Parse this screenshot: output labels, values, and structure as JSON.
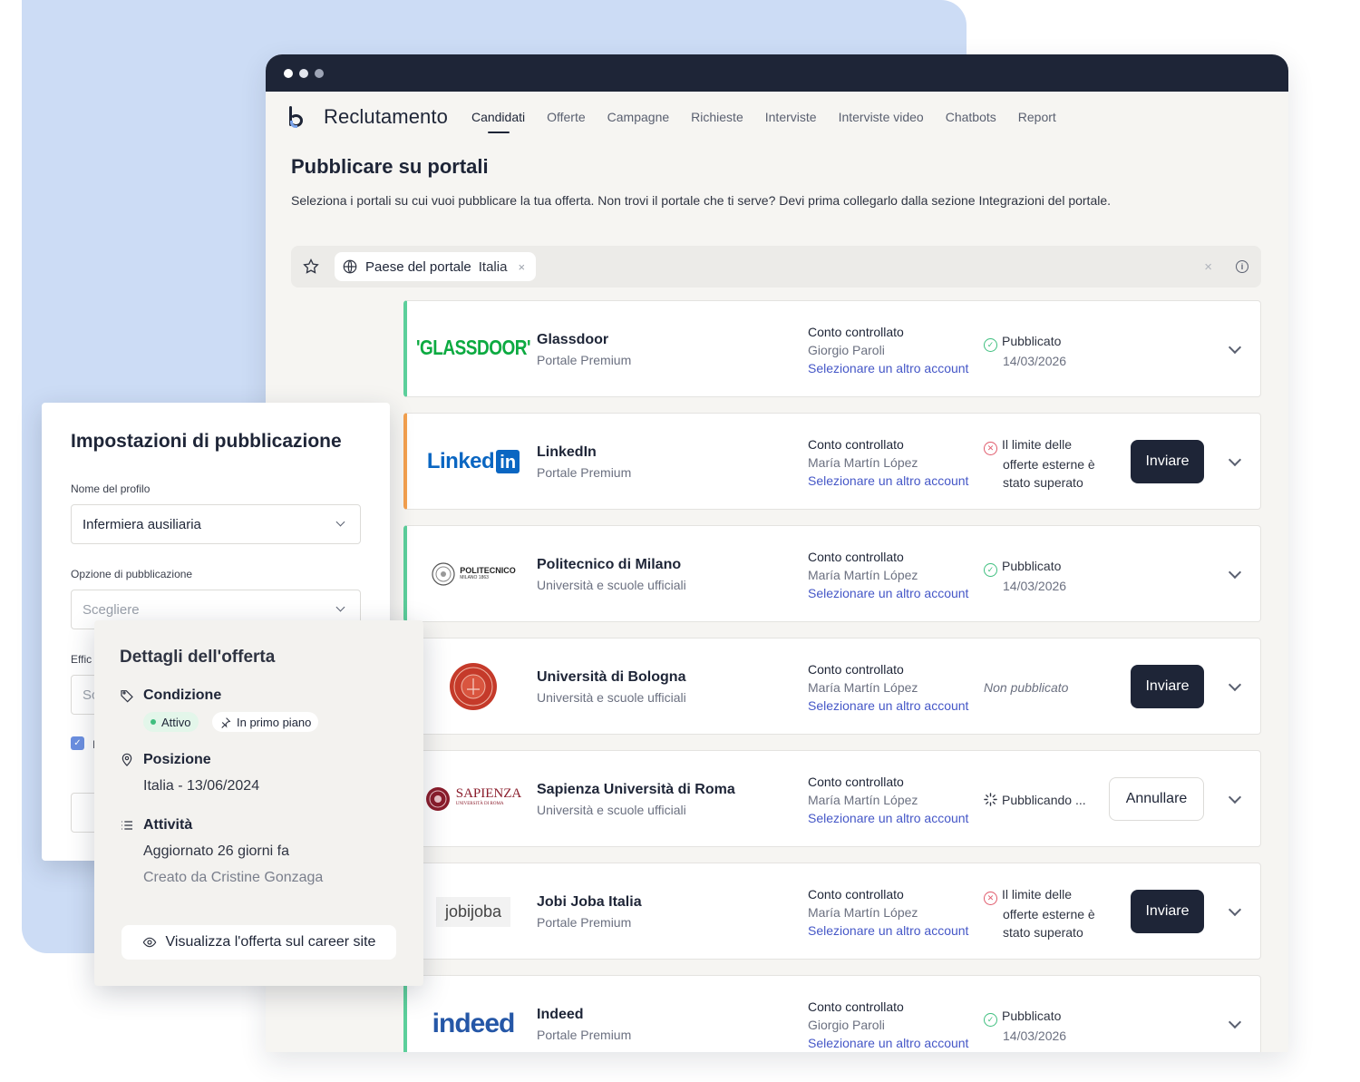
{
  "app": {
    "title": "Reclutamento",
    "nav": [
      "Candidati",
      "Offerte",
      "Campagne",
      "Richieste",
      "Interviste",
      "Interviste video",
      "Chatbots",
      "Report"
    ],
    "active_nav": "Candidati"
  },
  "page": {
    "title": "Pubblicare su portali",
    "description": "Seleziona i portali su cui vuoi pubblicare la tua offerta. Non trovi il portale che ti serve? Devi prima collegarlo dalla sezione Integrazioni del portale."
  },
  "filter": {
    "label": "Paese del portale",
    "value": "Italia",
    "remove": "×",
    "clear": "×",
    "info": "i"
  },
  "portals": [
    {
      "name": "Glassdoor",
      "type": "Portale Premium",
      "logo_text": "'GLASSDOOR'",
      "account_label": "Conto controllato",
      "account_name": "Giorgio Paroli",
      "account_link": "Selezionare un altro account",
      "status": "published",
      "status_text": "Pubblicato",
      "status_date": "14/03/2026",
      "action": "",
      "accent": "#5ccf9b"
    },
    {
      "name": "LinkedIn",
      "type": "Portale Premium",
      "logo_text": "Linked",
      "logo_text2": "in",
      "account_label": "Conto controllato",
      "account_name": "María Martín López",
      "account_link": "Selezionare un altro account",
      "status": "error",
      "status_lines": [
        "Il limite delle",
        "offerte esterne è",
        "stato superato"
      ],
      "action": "Inviare",
      "accent": "#f3a04e"
    },
    {
      "name": "Politecnico di Milano",
      "type": "Università e scuole ufficiali",
      "logo_text": "POLITECNICO",
      "logo_sub": "MILANO 1863",
      "account_label": "Conto controllato",
      "account_name": "María Martín López",
      "account_link": "Selezionare un altro account",
      "status": "published",
      "status_text": "Pubblicato",
      "status_date": "14/03/2026",
      "action": "",
      "accent": "#5ccf9b"
    },
    {
      "name": "Università di Bologna",
      "type": "Università e scuole ufficiali",
      "account_label": "Conto controllato",
      "account_name": "María Martín López",
      "account_link": "Selezionare un altro account",
      "status": "not_published",
      "status_text": "Non pubblicato",
      "action": "Inviare",
      "accent": "#5ccf9b"
    },
    {
      "name": "Sapienza Università di Roma",
      "type": "Università e scuole ufficiali",
      "logo_text": "SAPIENZA",
      "logo_sub": "UNIVERSITÀ DI ROMA",
      "account_label": "Conto controllato",
      "account_name": "María Martín López",
      "account_link": "Selezionare un altro account",
      "status": "publishing",
      "status_text": "Pubblicando ...",
      "action": "Annullare",
      "accent": "#5ccf9b"
    },
    {
      "name": "Jobi Joba Italia",
      "type": "Portale Premium",
      "logo_text": "jobijoba",
      "account_label": "Conto controllato",
      "account_name": "María Martín López",
      "account_link": "Selezionare un altro account",
      "status": "error",
      "status_lines": [
        "Il limite delle",
        "offerte esterne è",
        "stato superato"
      ],
      "action": "Inviare",
      "accent": "#5ccf9b"
    },
    {
      "name": "Indeed",
      "type": "Portale Premium",
      "logo_text": "indeed",
      "account_label": "Conto controllato",
      "account_name": "Giorgio Paroli",
      "account_link": "Selezionare un altro account",
      "status": "published",
      "status_text": "Pubblicato",
      "status_date": "14/03/2026",
      "action": "",
      "accent": "#5ccf9b"
    }
  ],
  "settings": {
    "title": "Impostazioni di pubblicazione",
    "profile_label": "Nome del profilo",
    "profile_value": "Infermiera ausiliaria",
    "option_label": "Opzione di pubblicazione",
    "option_placeholder": "Scegliere",
    "truncated_label": "Effic",
    "truncated_input": "Sc",
    "truncated_check": "I"
  },
  "details": {
    "title": "Dettagli dell'offerta",
    "condition_label": "Condizione",
    "badge_active": "Attivo",
    "badge_featured": "In primo piano",
    "position_label": "Posizione",
    "position_value": "Italia - 13/06/2024",
    "activity_label": "Attività",
    "updated": "Aggiornato 26 giorni fa",
    "created": "Creato da Cristine Gonzaga",
    "view_button": "Visualizza l'offerta sul career site"
  },
  "colors": {
    "navy": "#1e2537",
    "link": "#4557c7",
    "success": "#3fbf7f",
    "error": "#e05a6b",
    "background_blob": "#ccdcf5"
  }
}
